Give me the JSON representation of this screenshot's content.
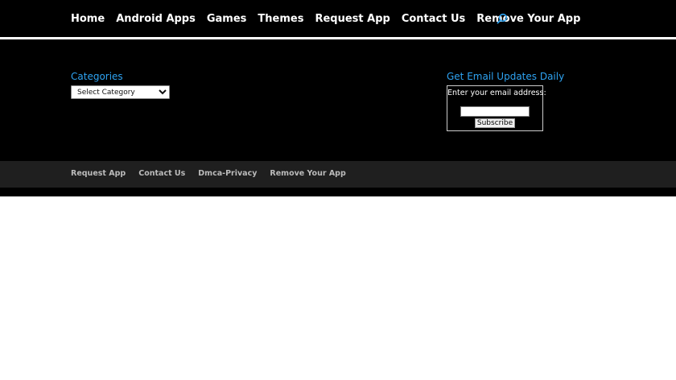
{
  "colors": {
    "nav_background": "#000000",
    "widget_title": "#2ea3f2",
    "footer_background": "#1f1f1f",
    "footer_link": "#bbbbbb"
  },
  "nav": {
    "items": [
      {
        "label": "Home"
      },
      {
        "label": "Android Apps"
      },
      {
        "label": "Games"
      },
      {
        "label": "Themes"
      },
      {
        "label": "Request App"
      },
      {
        "label": "Contact Us"
      },
      {
        "label": "Remove Your App"
      }
    ],
    "search_icon": "search-icon"
  },
  "widgets": {
    "categories": {
      "title": "Categories",
      "selected": "Select Category"
    },
    "email": {
      "title": "Get Email Updates Daily",
      "label": "Enter your email address:",
      "input_value": "",
      "button": "Subscribe"
    }
  },
  "footer": {
    "links": [
      {
        "label": "Request App"
      },
      {
        "label": "Contact Us"
      },
      {
        "label": "Dmca-Privacy"
      },
      {
        "label": "Remove Your App"
      }
    ]
  }
}
